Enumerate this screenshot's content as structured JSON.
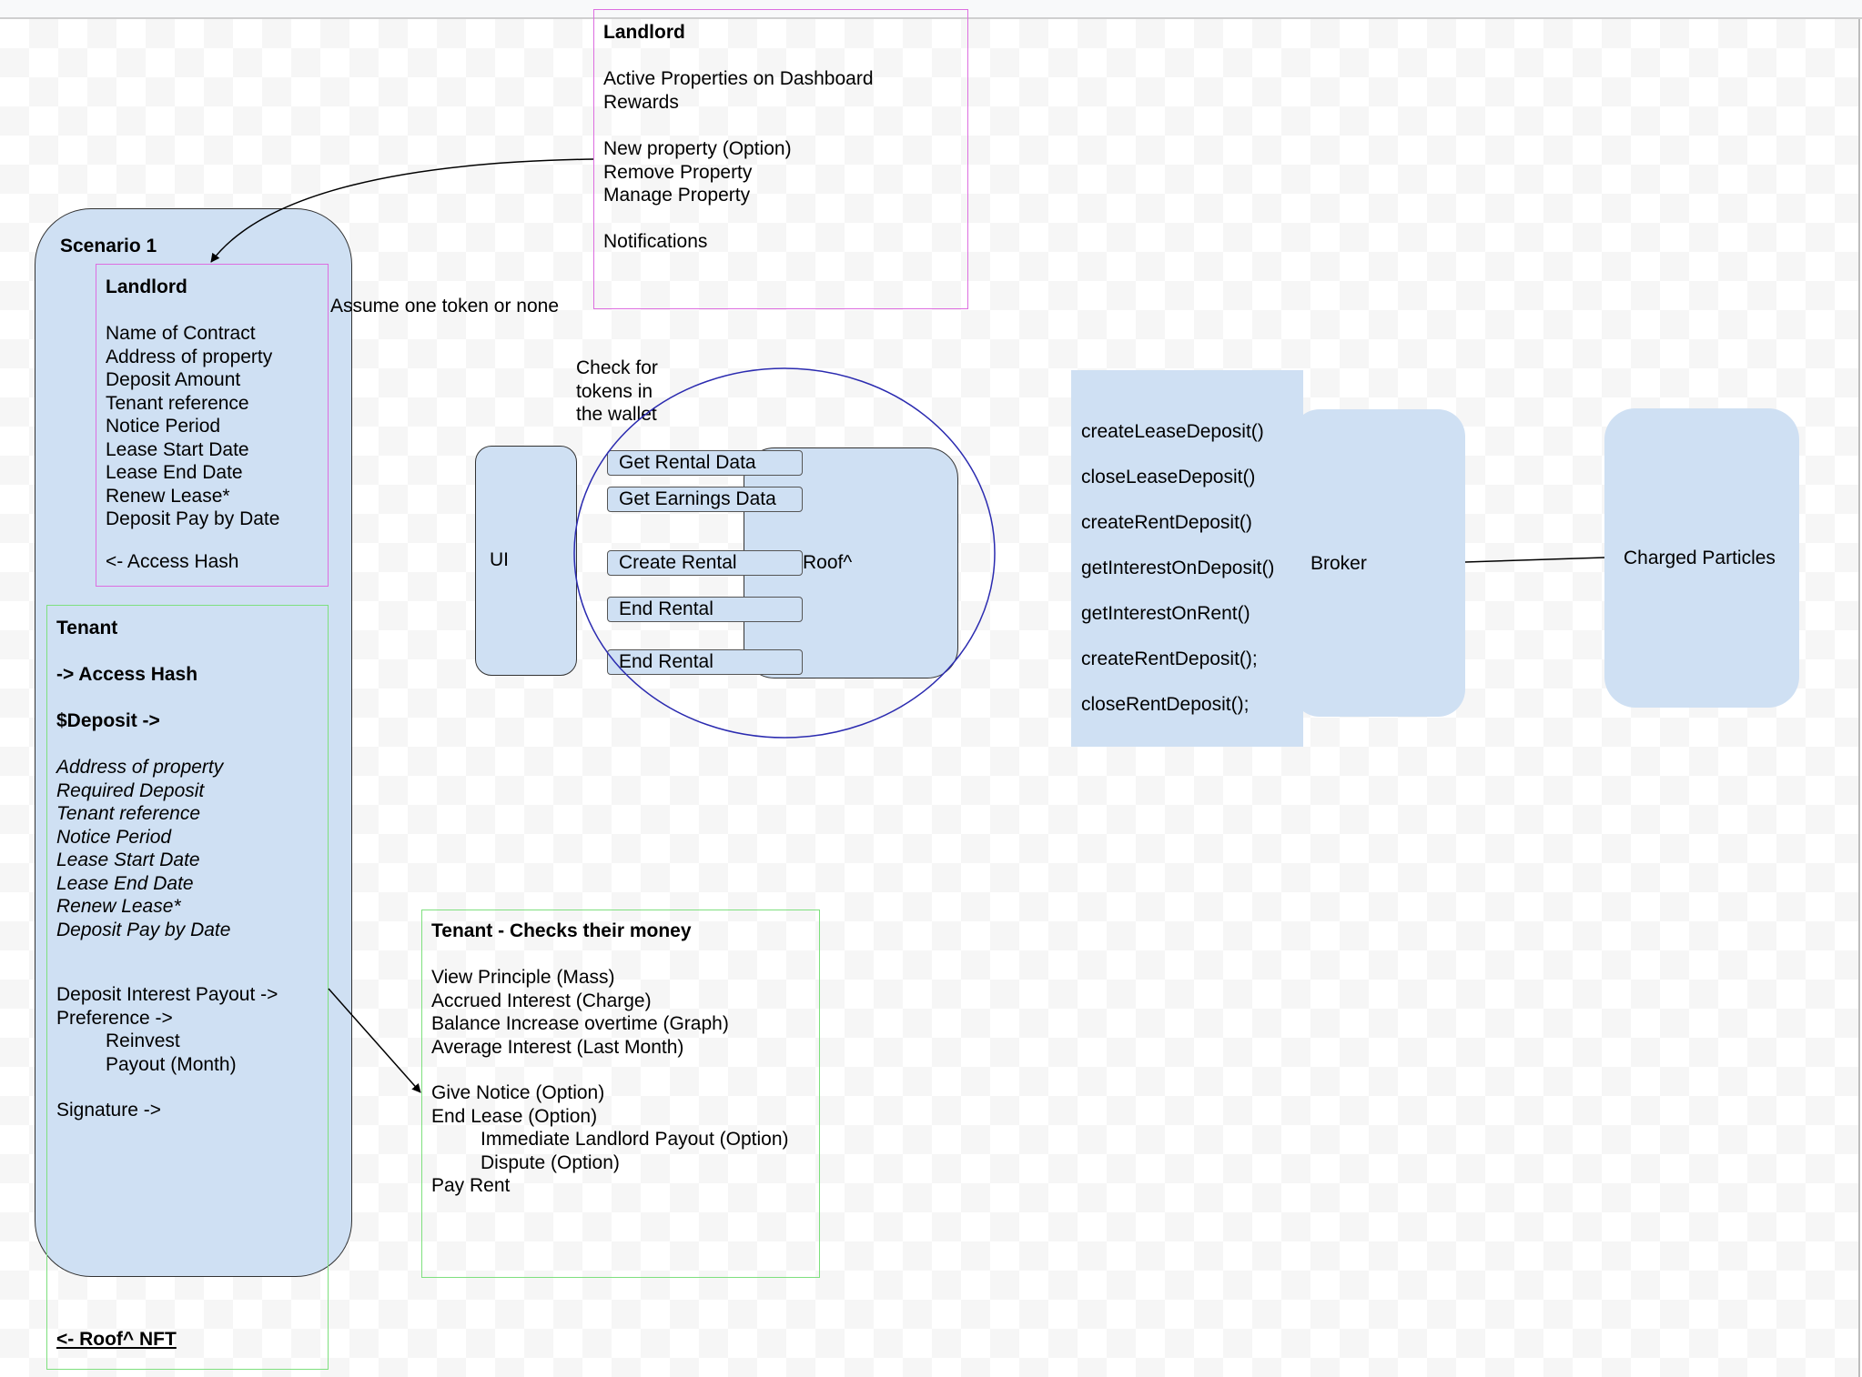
{
  "scenario": {
    "title": "Scenario 1",
    "landlord": {
      "title": "Landlord",
      "fields": [
        "Name of Contract",
        "Address of property",
        "Deposit Amount",
        "Tenant reference",
        "Notice Period",
        "Lease Start Date",
        "Lease End Date",
        "Renew Lease*",
        "Deposit Pay by Date"
      ],
      "access_hash": "<- Access Hash"
    },
    "tenant": {
      "title": "Tenant",
      "access_hash": "-> Access Hash",
      "deposit": "$Deposit ->",
      "fields": [
        "Address of property",
        "Required Deposit",
        "Tenant reference",
        "Notice Period",
        "Lease Start Date",
        "Lease End Date",
        "Renew Lease*",
        "Deposit Pay by Date"
      ],
      "payout_label": "Deposit Interest Payout ->",
      "preference_label": "Preference ->",
      "preference_options": [
        "Reinvest",
        "Payout (Month)"
      ],
      "signature": "Signature ->",
      "nft_link": "<- Roof^ NFT"
    }
  },
  "landlord_dashboard": {
    "title": "Landlord",
    "items_group1": [
      "Active Properties on Dashboard",
      "Rewards"
    ],
    "items_group2": [
      "New property (Option)",
      "Remove Property",
      "Manage Property"
    ],
    "items_group3": [
      "Notifications"
    ]
  },
  "annotations": {
    "assume_token": "Assume one token or none",
    "check_tokens": "Check for\ntokens in\nthe wallet"
  },
  "ui_box": {
    "label": "UI"
  },
  "roof": {
    "label": "Roof^",
    "actions": [
      "Get Rental Data",
      "Get Earnings Data",
      "Create Rental",
      "End Rental",
      "End Rental"
    ]
  },
  "broker": {
    "label": "Broker",
    "methods": [
      "createLeaseDeposit()",
      "closeLeaseDeposit()",
      "createRentDeposit()",
      "getInterestOnDeposit()",
      "getInterestOnRent()",
      "createRentDeposit();",
      "closeRentDeposit();"
    ]
  },
  "charged_particles": {
    "label": "Charged Particles"
  },
  "tenant_money": {
    "title": "Tenant - Checks their money",
    "view_items": [
      "View Principle (Mass)",
      "Accrued Interest (Charge)",
      "Balance Increase overtime (Graph)",
      "Average Interest (Last Month)"
    ],
    "give_notice": "Give Notice (Option)",
    "end_lease": "End Lease (Option)",
    "end_lease_options": [
      "Immediate Landlord Payout (Option)",
      "Dispute (Option)"
    ],
    "pay_rent": "Pay Rent"
  },
  "colors": {
    "shape_fill": "#cfe0f3",
    "landlord_border": "#dd6ee0",
    "tenant_border": "#7ee07e",
    "circle_stroke": "#2b2bb0"
  }
}
